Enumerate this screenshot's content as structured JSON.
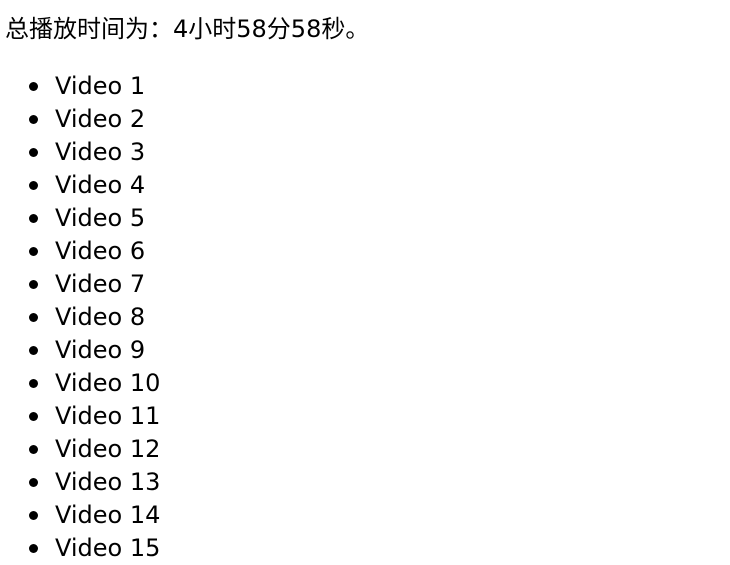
{
  "summary": {
    "text": "总播放时间为：4小时58分58秒。"
  },
  "videos": [
    {
      "label": "Video 1"
    },
    {
      "label": "Video 2"
    },
    {
      "label": "Video 3"
    },
    {
      "label": "Video 4"
    },
    {
      "label": "Video 5"
    },
    {
      "label": "Video 6"
    },
    {
      "label": "Video 7"
    },
    {
      "label": "Video 8"
    },
    {
      "label": "Video 9"
    },
    {
      "label": "Video 10"
    },
    {
      "label": "Video 11"
    },
    {
      "label": "Video 12"
    },
    {
      "label": "Video 13"
    },
    {
      "label": "Video 14"
    },
    {
      "label": "Video 15"
    }
  ]
}
